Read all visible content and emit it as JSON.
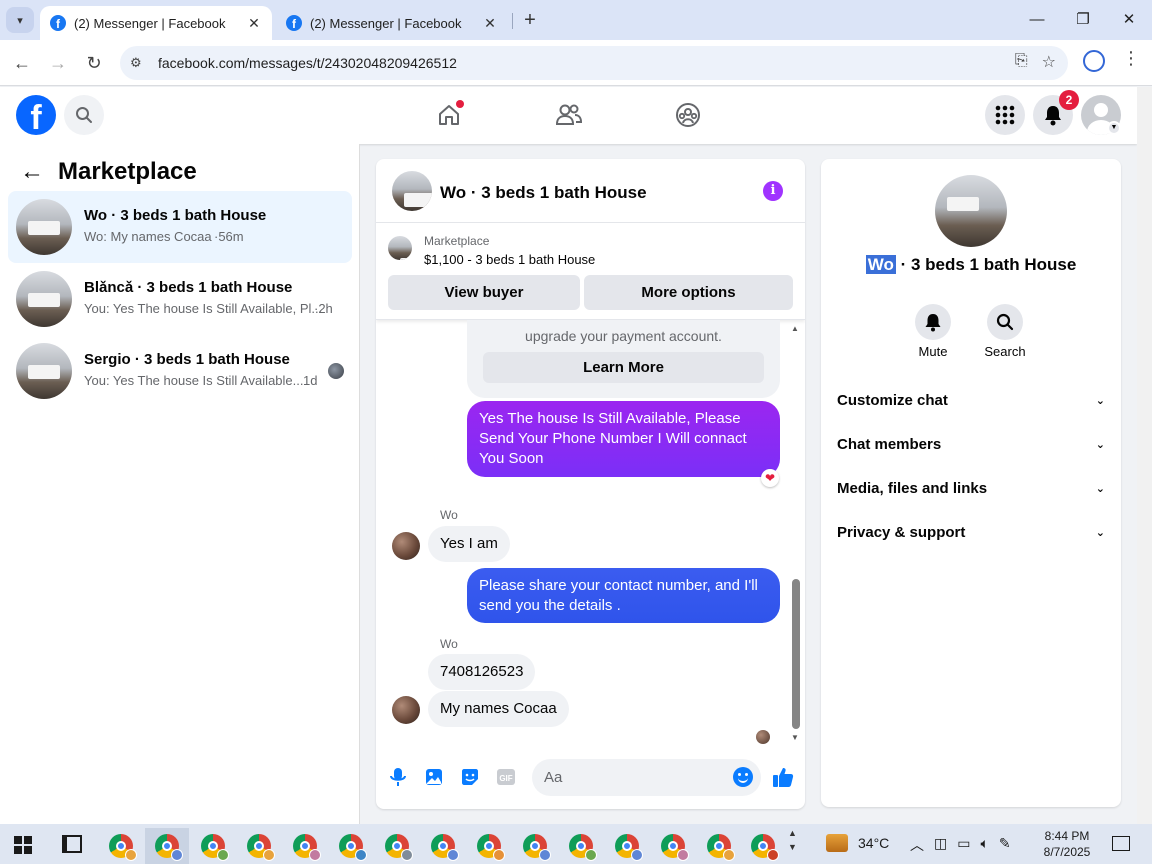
{
  "browser": {
    "tabs": [
      {
        "label": "(2) Messenger | Facebook",
        "active": true
      },
      {
        "label": "(2) Messenger | Facebook",
        "active": false
      }
    ],
    "url": "facebook.com/messages/t/24302048209426512"
  },
  "fb_header": {
    "notification_count": "2",
    "nav_icons": [
      "home-icon",
      "friends-icon",
      "groups-icon"
    ]
  },
  "sidebar": {
    "title": "Marketplace",
    "conversations": [
      {
        "title": "Wo · 3 beds 1 bath House",
        "preview": "Wo: My names Cocaa",
        "time": "·56m",
        "active": true
      },
      {
        "title": "Blǎncǎ · 3 beds 1 bath House",
        "preview": "You: Yes The house Is Still Available, Pl...",
        "time": "·2h",
        "active": false
      },
      {
        "title": "Sergio · 3 beds 1 bath House",
        "preview": "You: Yes The house Is Still Available...",
        "time": "1d",
        "active": false
      }
    ]
  },
  "chat": {
    "title": "Wo · 3 beds 1 bath House",
    "listing": {
      "label": "Marketplace",
      "price_title": "$1,100 - 3 beds 1 bath House",
      "view_buyer": "View buyer",
      "more_options": "More options"
    },
    "ad": {
      "text": "upgrade your payment account.",
      "button": "Learn More"
    },
    "messages": {
      "out1": "Yes The house Is Still Available, Please Send Your Phone Number I Will connact You Soon",
      "sender1": "Wo",
      "in1": "Yes I am",
      "out2": "Please share your contact number, and I'll send you the details .",
      "sender2": "Wo",
      "in2": "7408126523",
      "in3": "My names Cocaa"
    },
    "composer": {
      "placeholder": "Aa"
    },
    "colors": {
      "purple": "#a033ff",
      "blue": "#0a7cff",
      "violet": "#7b2ff7"
    }
  },
  "details": {
    "name_highlight": "Wo",
    "name_rest": " · 3 beds 1 bath House",
    "actions": {
      "mute": "Mute",
      "search": "Search"
    },
    "sections": [
      "Customize chat",
      "Chat members",
      "Media, files and links",
      "Privacy & support"
    ]
  },
  "taskbar": {
    "weather": "34°C",
    "time": "8:44 PM",
    "date": "8/7/2025"
  }
}
